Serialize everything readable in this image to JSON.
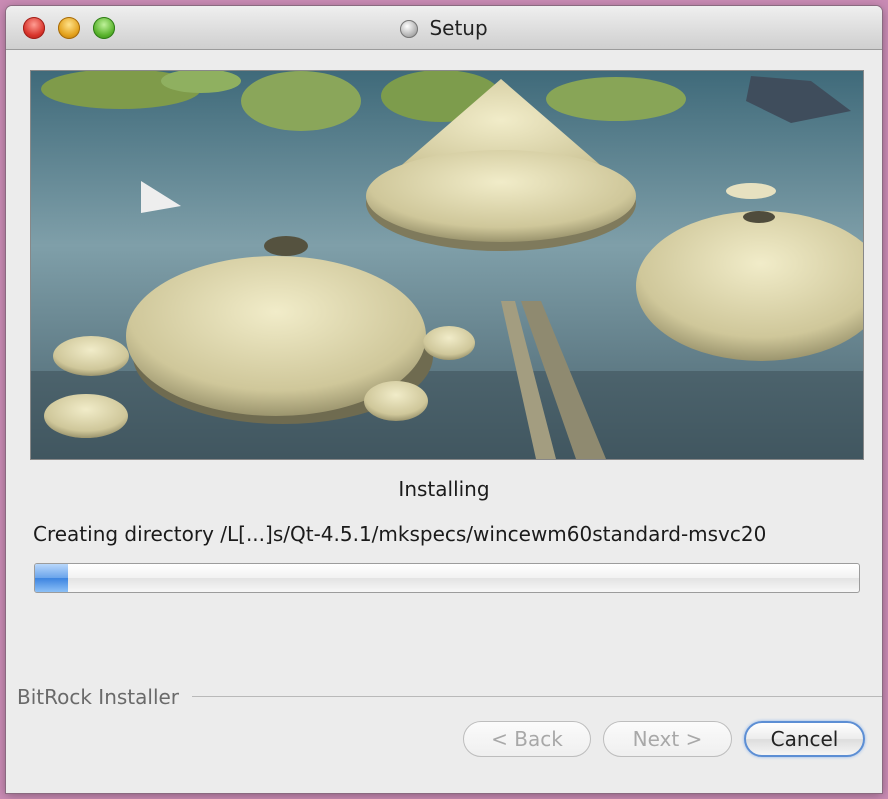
{
  "window": {
    "title": "Setup",
    "icon": "setup-gear-icon"
  },
  "banner": {
    "description": "installer-banner-image"
  },
  "status": {
    "heading": "Installing",
    "detail": "Creating directory /L[...]s/Qt-4.5.1/mkspecs/wincewm60standard-msvc20",
    "progress_fraction": 0.04
  },
  "footer": {
    "vendor": "BitRock Installer"
  },
  "buttons": {
    "back": "< Back",
    "next": "Next >",
    "cancel": "Cancel"
  },
  "colors": {
    "progress_accent": "#3d84e0",
    "default_button_ring": "#5c8ed4"
  }
}
